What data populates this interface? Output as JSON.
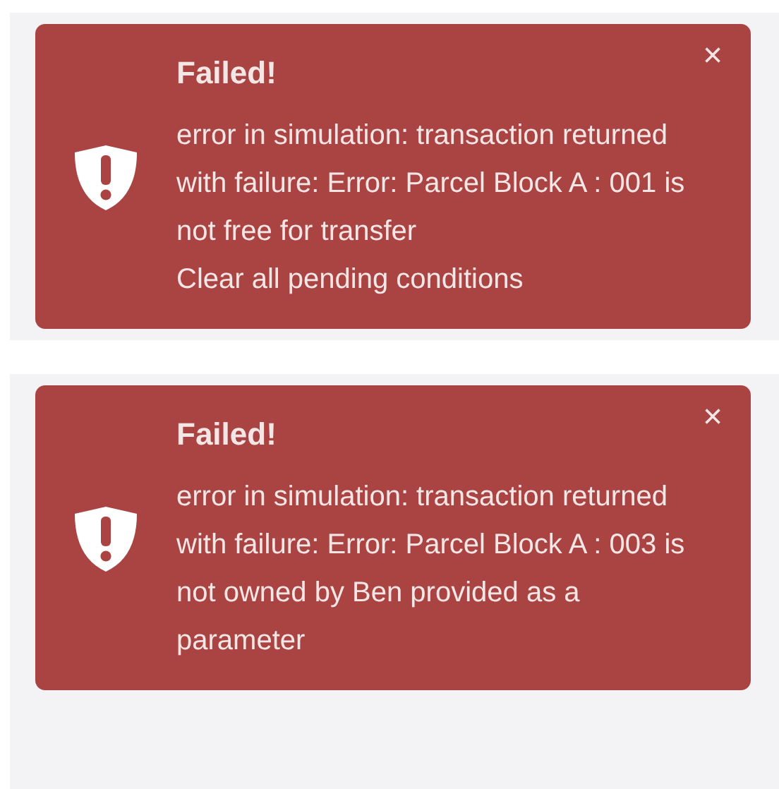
{
  "alerts": [
    {
      "title": "Failed!",
      "close": "×",
      "messages": [
        "error in simulation: transaction returned with failure: Error: Parcel Block A : 001 is not free for transfer",
        "Clear all pending conditions"
      ]
    },
    {
      "title": "Failed!",
      "close": "×",
      "messages": [
        "error in simulation: transaction returned with failure: Error: Parcel Block A : 003 is not owned by Ben provided as a parameter"
      ]
    }
  ]
}
